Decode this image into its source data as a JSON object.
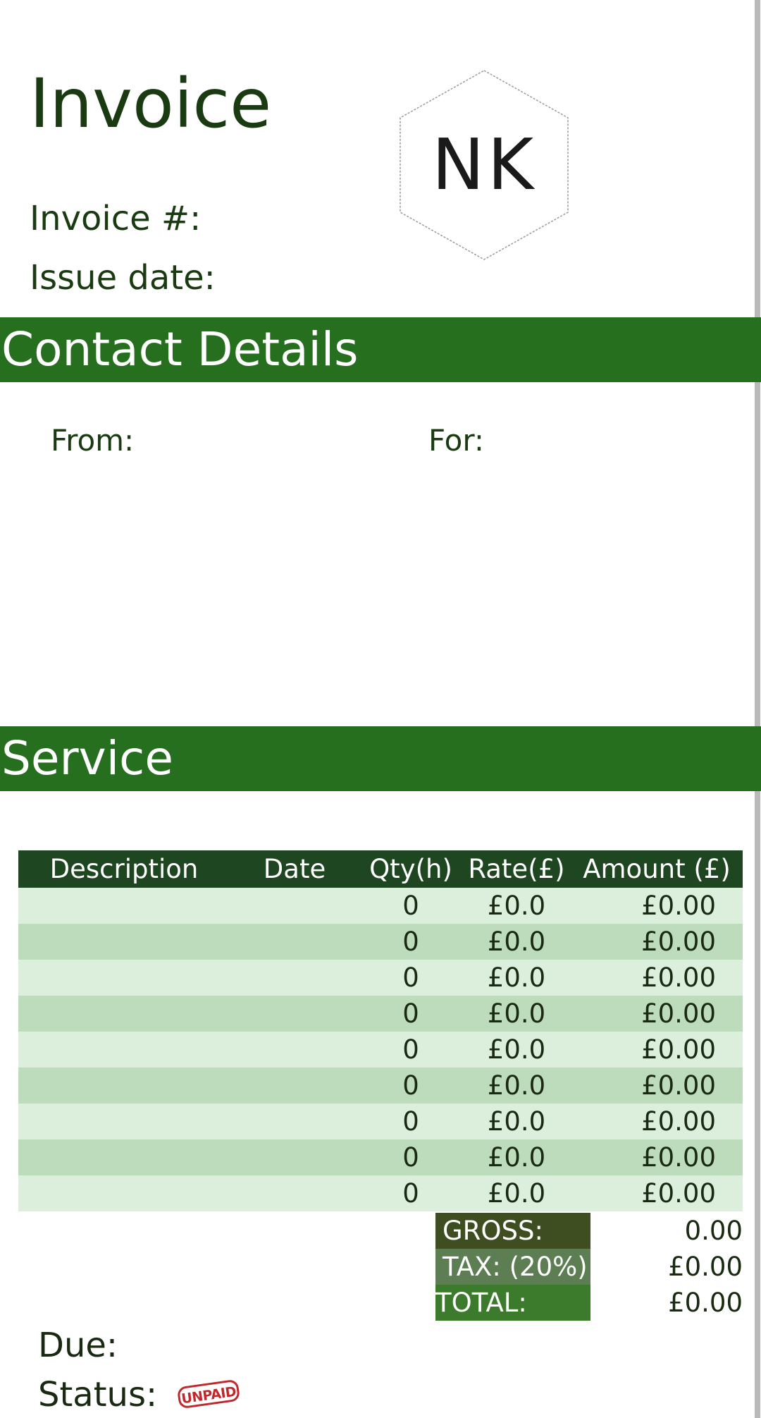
{
  "header": {
    "title": "Invoice",
    "invoice_number_label": "Invoice #:",
    "issue_date_label": "Issue date:",
    "logo_text": "NK"
  },
  "contact": {
    "section_title": "Contact Details",
    "from_label": "From:",
    "for_label": "For:"
  },
  "service": {
    "section_title": "Service",
    "columns": [
      "Description",
      "Date",
      "Qty(h)",
      "Rate(£)",
      "Amount (£)"
    ],
    "rows": [
      {
        "description": "",
        "date": "",
        "qty": "0",
        "rate": "£0.0",
        "amount": "£0.00"
      },
      {
        "description": "",
        "date": "",
        "qty": "0",
        "rate": "£0.0",
        "amount": "£0.00"
      },
      {
        "description": "",
        "date": "",
        "qty": "0",
        "rate": "£0.0",
        "amount": "£0.00"
      },
      {
        "description": "",
        "date": "",
        "qty": "0",
        "rate": "£0.0",
        "amount": "£0.00"
      },
      {
        "description": "",
        "date": "",
        "qty": "0",
        "rate": "£0.0",
        "amount": "£0.00"
      },
      {
        "description": "",
        "date": "",
        "qty": "0",
        "rate": "£0.0",
        "amount": "£0.00"
      },
      {
        "description": "",
        "date": "",
        "qty": "0",
        "rate": "£0.0",
        "amount": "£0.00"
      },
      {
        "description": "",
        "date": "",
        "qty": "0",
        "rate": "£0.0",
        "amount": "£0.00"
      },
      {
        "description": "",
        "date": "",
        "qty": "0",
        "rate": "£0.0",
        "amount": "£0.00"
      }
    ]
  },
  "summary": {
    "gross_label": "GROSS:",
    "gross_value": "0.00",
    "tax_label": "TAX: (20%)",
    "tax_value": "£0.00",
    "total_label": "TOTAL:",
    "total_value": "£0.00"
  },
  "footer": {
    "due_label": "Due:",
    "status_label": "Status:",
    "status_stamp": "UNPAID"
  },
  "colors": {
    "section_bar": "#266f1e",
    "table_header": "#1e4620",
    "row_light": "#dcefdc",
    "row_dark": "#bcdcbc",
    "stamp_red": "#c0282d"
  }
}
